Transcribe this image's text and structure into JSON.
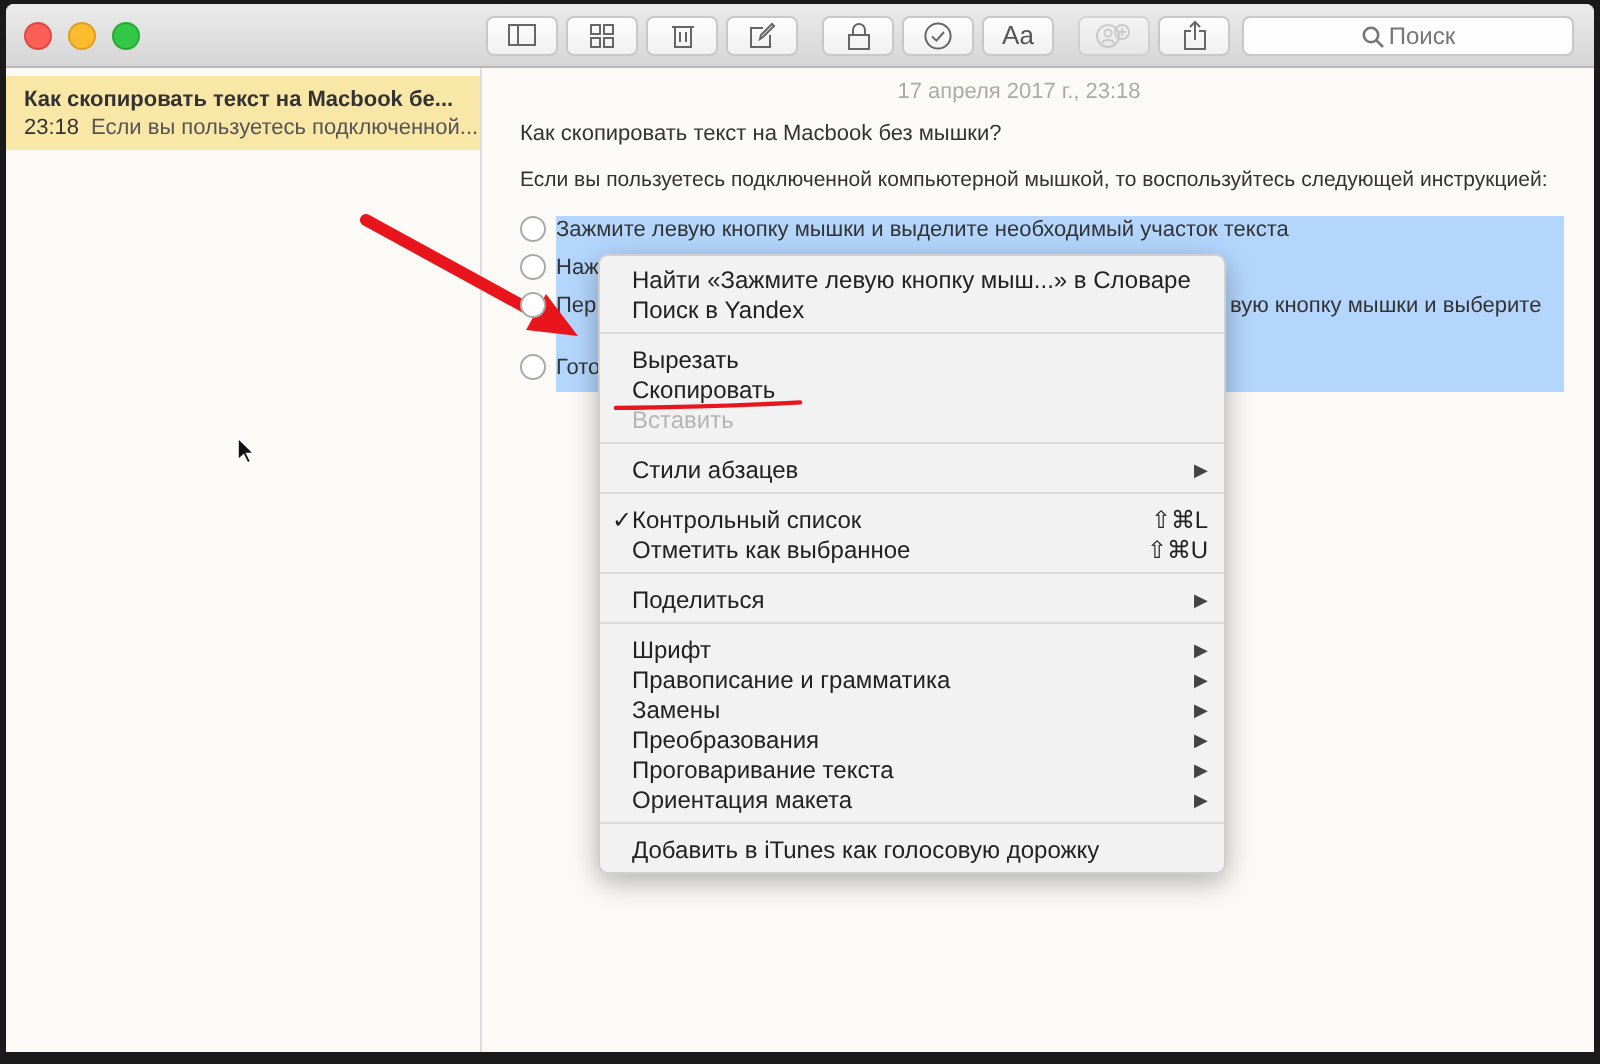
{
  "toolbar": {
    "buttons": [
      {
        "kind": "sidebar",
        "disabled": false
      },
      {
        "kind": "grid",
        "disabled": false
      },
      {
        "kind": "trash",
        "disabled": false
      },
      {
        "kind": "compose",
        "disabled": false
      },
      {
        "kind": "lock",
        "disabled": false
      },
      {
        "kind": "check",
        "disabled": false
      },
      {
        "kind": "text",
        "label": "Aa",
        "disabled": false
      },
      {
        "kind": "people",
        "disabled": true
      },
      {
        "kind": "share",
        "disabled": false
      }
    ],
    "search": {
      "placeholder": "Поиск"
    }
  },
  "notes": [
    {
      "title": "Как скопировать текст на Macbook бе...",
      "time": "23:18",
      "preview": "Если вы пользуетесь подключенной...",
      "selected": true
    }
  ],
  "note": {
    "date": "17 апреля 2017 г., 23:18",
    "title": "Как скопировать текст на Macbook без мышки?",
    "paragraph": "Если вы пользуетесь подключенной компьютерной мышкой, то воспользуйтесь следующей инструкцией:",
    "checklist": [
      {
        "start": "Зажмите левую кнопку мышки и выделите необходимый участок текста",
        "checked": false,
        "highlighted": true
      },
      {
        "start": "Наж",
        "checked": false,
        "highlighted": true
      },
      {
        "start": "Пер",
        "end": "вую кнопку мышки и выберите",
        "checked": false,
        "highlighted": true
      },
      {
        "start": "Гото",
        "checked": false,
        "highlighted": true
      }
    ]
  },
  "context_menu": {
    "check_glyph": "✓",
    "groups": [
      [
        {
          "label": "Найти «Зажмите левую кнопку мыш...» в Словаре",
          "disabled": false,
          "checked": false
        },
        {
          "label": "Поиск в Yandex",
          "disabled": false,
          "checked": false
        }
      ],
      [
        {
          "label": "Вырезать",
          "disabled": false,
          "checked": false
        },
        {
          "label": "Скопировать",
          "disabled": false,
          "checked": false
        },
        {
          "label": "Вставить",
          "disabled": true,
          "checked": false
        }
      ],
      [
        {
          "label": "Стили абзацев",
          "disabled": false,
          "checked": false,
          "submenu": "▶"
        }
      ],
      [
        {
          "label": "Контрольный список",
          "disabled": false,
          "checked": true,
          "shortcut": "⇧⌘L"
        },
        {
          "label": "Отметить как выбранное",
          "disabled": false,
          "checked": false,
          "shortcut": "⇧⌘U"
        }
      ],
      [
        {
          "label": "Поделиться",
          "disabled": false,
          "checked": false,
          "submenu": "▶"
        }
      ],
      [
        {
          "label": "Шрифт",
          "disabled": false,
          "checked": false,
          "submenu": "▶"
        },
        {
          "label": "Правописание и грамматика",
          "disabled": false,
          "checked": false,
          "submenu": "▶"
        },
        {
          "label": "Замены",
          "disabled": false,
          "checked": false,
          "submenu": "▶"
        },
        {
          "label": "Преобразования",
          "disabled": false,
          "checked": false,
          "submenu": "▶"
        },
        {
          "label": "Проговаривание текста",
          "disabled": false,
          "checked": false,
          "submenu": "▶"
        },
        {
          "label": "Ориентация макета",
          "disabled": false,
          "checked": false,
          "submenu": "▶"
        }
      ],
      [
        {
          "label": "Добавить в iTunes как голосовую дорожку",
          "disabled": false,
          "checked": false
        }
      ]
    ]
  }
}
